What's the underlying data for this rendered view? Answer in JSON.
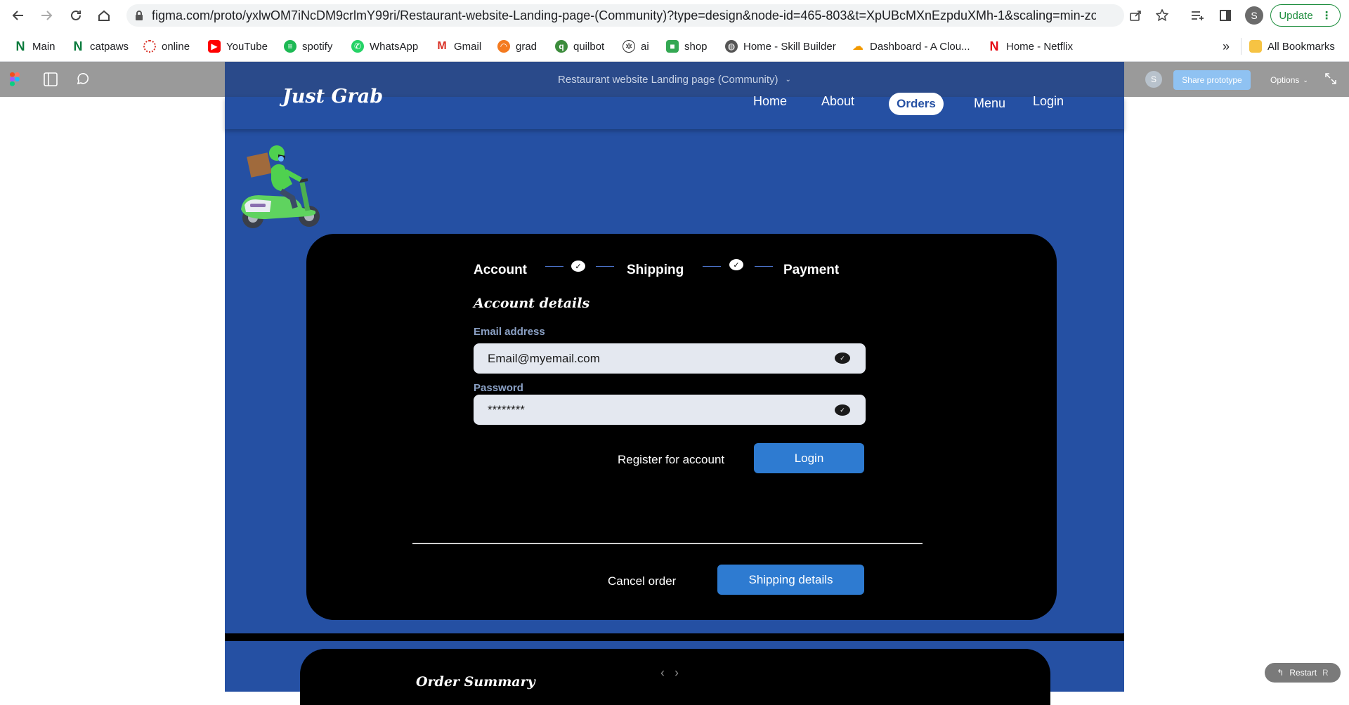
{
  "browser": {
    "url": "figma.com/proto/yxlwOM7iNcDM9crlmY99ri/Restaurant-website-Landing-page-(Community)?type=design&node-id=465-803&t=XpUBcMXnEzpduXMh-1&scaling=min-zoom...",
    "profile_initial": "S",
    "update_label": "Update",
    "bookmarks": [
      "Main",
      "catpaws",
      "online",
      "YouTube",
      "spotify",
      "WhatsApp",
      "Gmail",
      "grad",
      "quilbot",
      "ai",
      "shop",
      "Home - Skill Builder",
      "Dashboard - A Clou...",
      "Home - Netflix"
    ],
    "more_bookmarks": "»",
    "all_bookmarks": "All Bookmarks"
  },
  "figma": {
    "title": "Restaurant website Landing page (Community)",
    "avatar_initial": "S",
    "share_label": "Share prototype",
    "options_label": "Options",
    "restart_label": "Restart",
    "restart_shortcut": "R"
  },
  "site": {
    "logo": "Just Grab",
    "nav": {
      "home": "Home",
      "about": "About",
      "orders": "Orders",
      "menu": "Menu",
      "login": "Login"
    }
  },
  "checkout": {
    "steps": [
      "Account",
      "Shipping",
      "Payment"
    ],
    "section_title": "Account details",
    "email_label": "Email address",
    "email_value": "Email@myemail.com",
    "password_label": "Password",
    "password_value": "********",
    "register_label": "Register for account",
    "login_label": "Login",
    "cancel_label": "Cancel order",
    "next_label": "Shipping details"
  },
  "summary": {
    "title": "Order Summary"
  },
  "colors": {
    "site_blue": "#2550a3",
    "button_blue": "#2e7bd1",
    "card": "#000000"
  }
}
